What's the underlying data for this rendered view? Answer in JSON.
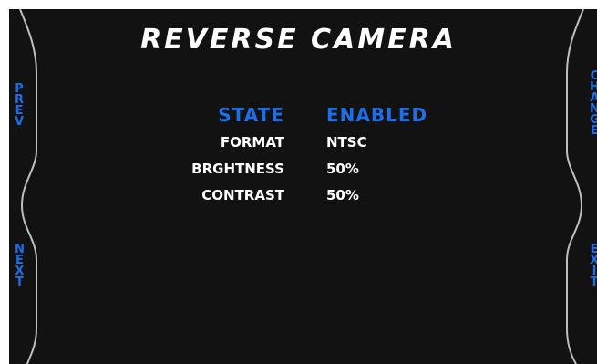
{
  "title": "REVERSE CAMERA",
  "left_buttons": {
    "prev": [
      "P",
      "R",
      "E",
      "V"
    ],
    "next": [
      "N",
      "E",
      "X",
      "T"
    ]
  },
  "right_buttons": {
    "change": [
      "C",
      "H",
      "A",
      "N",
      "G",
      "E"
    ],
    "exit": [
      "E",
      "X",
      "I",
      "T"
    ]
  },
  "settings": [
    {
      "label": "STATE",
      "value": "ENABLED"
    },
    {
      "label": "FORMAT",
      "value": "NTSC"
    },
    {
      "label": "BRGHTNESS",
      "value": "50%"
    },
    {
      "label": "CONTRAST",
      "value": "50%"
    }
  ],
  "colors": {
    "accent": "#1c6fe8",
    "background": "#121212",
    "text": "#ffffff",
    "frame_line": "#bfbfbf"
  }
}
